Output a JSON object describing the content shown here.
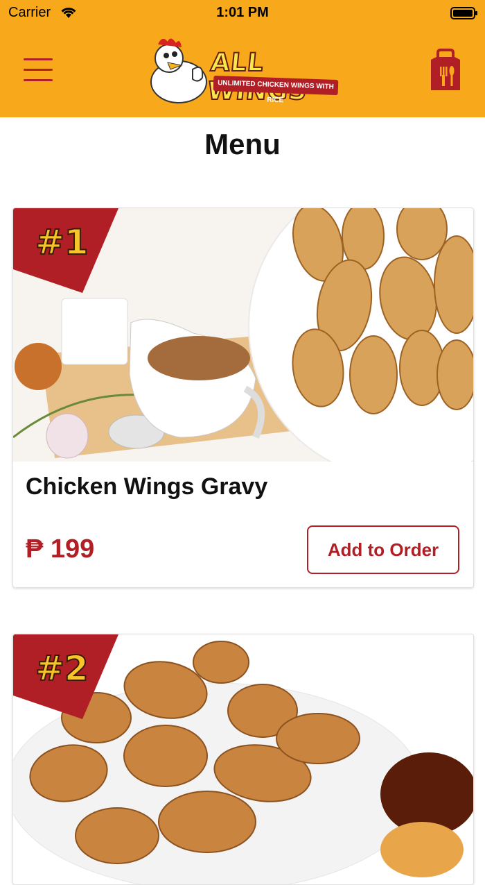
{
  "status_bar": {
    "carrier": "Carrier",
    "time": "1:01 PM"
  },
  "header": {
    "logo_wordmark": "ALL WINGS",
    "logo_tagline": "UNLIMITED CHICKEN WINGS WITH RICE",
    "accent_color": "#F7A81B",
    "brand_red": "#B11F26",
    "menu_icon": "hamburger-icon",
    "bag_icon": "takeout-bag-icon"
  },
  "page": {
    "title": "Menu"
  },
  "items": [
    {
      "badge": "#1",
      "name": "Chicken Wings Gravy",
      "price": "₱ 199",
      "button_label": "Add to Order"
    },
    {
      "badge": "#2"
    }
  ]
}
